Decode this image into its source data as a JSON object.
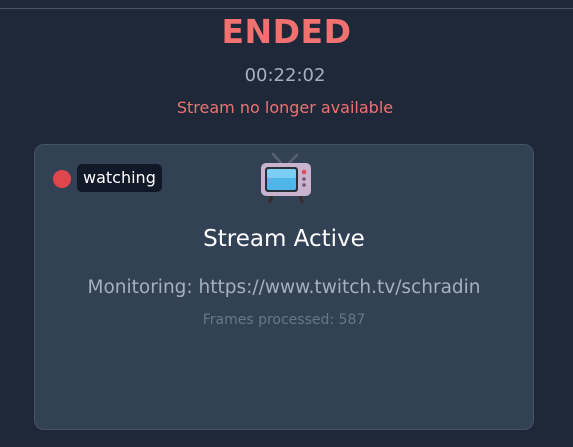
{
  "stream_status": {
    "title": "ENDED",
    "elapsed": "00:22:02",
    "message": "Stream no longer available"
  },
  "card": {
    "badge_label": "watching",
    "icon": "tv-icon",
    "title": "Stream Active",
    "monitor_label": "Monitoring:",
    "monitor_url": "https://www.twitch.tv/schradin",
    "frames_label": "Frames processed:",
    "frames_count": "587"
  },
  "colors": {
    "background": "#1f2839",
    "card": "#334155",
    "alert": "#f17171",
    "live_dot": "#e0474c",
    "badge": "#111827"
  }
}
